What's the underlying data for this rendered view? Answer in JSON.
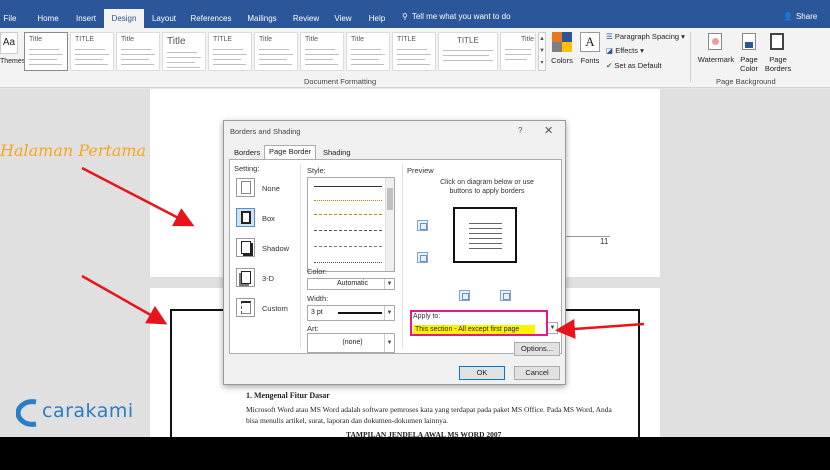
{
  "ribbon_tabs": [
    "File",
    "Home",
    "Insert",
    "Design",
    "Layout",
    "References",
    "Mailings",
    "Review",
    "View",
    "Help"
  ],
  "active_tab": "Design",
  "tell_me": "Tell me what you want to do",
  "share": "Share",
  "ribbon": {
    "themes_label": "Themes",
    "theme_letters": "Aa",
    "style_thumbs": [
      "Title",
      "TITLE",
      "Title",
      "Title",
      "TITLE",
      "Title",
      "Title",
      "Title",
      "TITLE",
      "Title"
    ],
    "colors_label": "Colors",
    "fonts_label": "Fonts",
    "paragraph_spacing": "Paragraph Spacing",
    "effects": "Effects",
    "set_default": "Set as Default",
    "group_document_formatting": "Document Formatting",
    "watermark": "Watermark",
    "page_color": "Page Color",
    "page_borders": "Page Borders",
    "group_page_background": "Page Background"
  },
  "document": {
    "page_number": "11",
    "section_title": "1.     Mengenal Fitur Dasar",
    "paragraph": "Microsoft Word atau MS Word adalah software pemroses kata yang terdapat pada paket MS Office. Pada MS Word, Anda bisa menulis artikel, surat, laporan dan dokumen-dokumen lainnya.",
    "subheading": "TAMPILAN JENDELA AWAL MS WORD 2007"
  },
  "dialog": {
    "title": "Borders and Shading",
    "help": "?",
    "close": "✕",
    "tabs": [
      "Borders",
      "Page Border",
      "Shading"
    ],
    "active_tab": "Page Border",
    "setting_label": "Setting:",
    "settings": [
      "None",
      "Box",
      "Shadow",
      "3-D",
      "Custom"
    ],
    "selected_setting": "Box",
    "style_label": "Style:",
    "color_label": "Color:",
    "color_value": "Automatic",
    "width_label": "Width:",
    "width_value": "3 pt",
    "art_label": "Art:",
    "art_value": "(none)",
    "preview_label": "Preview",
    "preview_hint": "Click on diagram below or use buttons to apply borders",
    "apply_to_label": "Apply to:",
    "apply_to_value": "This section - All except first page",
    "options_button": "Options...",
    "ok_button": "OK",
    "cancel_button": "Cancel"
  },
  "annotations": {
    "label": "Halaman Pertama",
    "label_color": "#f7a51b",
    "arrow_color": "#e8141b",
    "highlight_color": "#fff200",
    "outline_color": "#e21a8c"
  },
  "brand": {
    "name": "carakami",
    "color": "#2d7dc6"
  }
}
